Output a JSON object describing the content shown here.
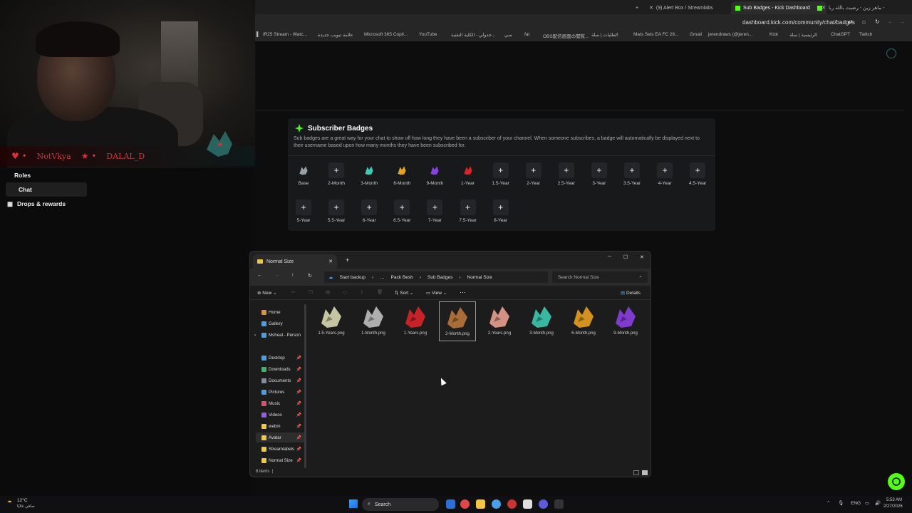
{
  "webcam": {
    "overlay_names": [
      "NotVkya",
      "DALAL_D"
    ]
  },
  "browser": {
    "tabs": [
      "(9) Alert Box / Streamlabs",
      "Sub Badges - Kick Dashboard",
      "ماهر زين - رضيت بالله ربا -"
    ],
    "url": "dashboard.kick.com/community/chat/badges",
    "bookmarks": [
      "iR25 Stream - Watc...",
      "علامة تبويب جديدة",
      "Microsoft 365 Copil...",
      "YouTube",
      "جدولي - الكلية التقنية...",
      "سي",
      "fat",
      "OBS配信画面の閲覧...",
      "الطلبات | سلة",
      "Mats Sels EA FC 26...",
      "Gmail",
      "jerendraws (@jeren...",
      "Kick",
      "الرئيسية | سلة",
      "ChatGPT",
      "Twitch"
    ]
  },
  "sidebar": {
    "items": [
      {
        "label": "Roles"
      },
      {
        "label": "Chat"
      },
      {
        "label": "Drops & rewards"
      }
    ]
  },
  "badges": {
    "title": "Subscriber Badges",
    "description": "Sub badges are a great way for your chat to show off how long they have been a subscriber of your channel. When someone subscribes, a badge will automatically be displayed next to their username based upon how many months they have been subscribed for.",
    "row1": [
      "Base",
      "2-Month",
      "3-Month",
      "6-Month",
      "9-Month",
      "1-Year",
      "1.5-Year",
      "2-Year",
      "2.5-Year",
      "3-Year",
      "3.5-Year",
      "4-Year",
      "4.5-Year"
    ],
    "row2": [
      "5-Year",
      "5.5-Year",
      "6-Year",
      "6.5-Year",
      "7-Year",
      "7.5-Year",
      "8-Year"
    ],
    "filled": {
      "Base": "#9aa0a6",
      "3-Month": "#3ec9b0",
      "6-Month": "#e8a020",
      "9-Month": "#8a3fe0",
      "1-Year": "#d8252a"
    },
    "add_symbol": "+"
  },
  "explorer": {
    "tab_title": "Normal Size",
    "path": [
      "Start backup",
      "Pack Besh",
      "Sub Badges",
      "Normal Size"
    ],
    "search_placeholder": "Search Normal Size",
    "toolbar": {
      "new": "New",
      "sort": "Sort",
      "view": "View",
      "details": "Details"
    },
    "nav": [
      {
        "label": "Home",
        "color": "#e0913f"
      },
      {
        "label": "Gallery",
        "color": "#4aa0e8"
      },
      {
        "label": "Msheal - Person",
        "color": "#4aa0e8"
      },
      {
        "label": "Desktop",
        "color": "#4aa0e8"
      },
      {
        "label": "Downloads",
        "color": "#3fb56a"
      },
      {
        "label": "Documents",
        "color": "#7c8ea0"
      },
      {
        "label": "Pictures",
        "color": "#4aa0e8"
      },
      {
        "label": "Music",
        "color": "#e0506a"
      },
      {
        "label": "Videos",
        "color": "#9a5ae8"
      },
      {
        "label": "webm",
        "color": "#f4c542"
      },
      {
        "label": "Avatar",
        "color": "#f4c542"
      },
      {
        "label": "Streamlabels",
        "color": "#f4c542"
      },
      {
        "label": "Normal Size",
        "color": "#f4c542"
      }
    ],
    "files": [
      {
        "name": "1.5-Years.png",
        "color": "#d8d8b0"
      },
      {
        "name": "1-Month.png",
        "color": "#bfbfbf"
      },
      {
        "name": "1-Years.png",
        "color": "#d8252a"
      },
      {
        "name": "2-Month.png",
        "color": "#b8753a"
      },
      {
        "name": "2-Years.png",
        "color": "#e8a090"
      },
      {
        "name": "3-Month.png",
        "color": "#3ec9b0"
      },
      {
        "name": "6-Month.png",
        "color": "#e8a020"
      },
      {
        "name": "9-Month.png",
        "color": "#8a3fe0"
      }
    ],
    "status": "8 items"
  },
  "taskbar": {
    "weather": "12°C",
    "weather_sub": "صافي غالبًا",
    "search": "Search",
    "lang": "ENG",
    "time": "5:53 AM",
    "date": "2/27/2026"
  }
}
